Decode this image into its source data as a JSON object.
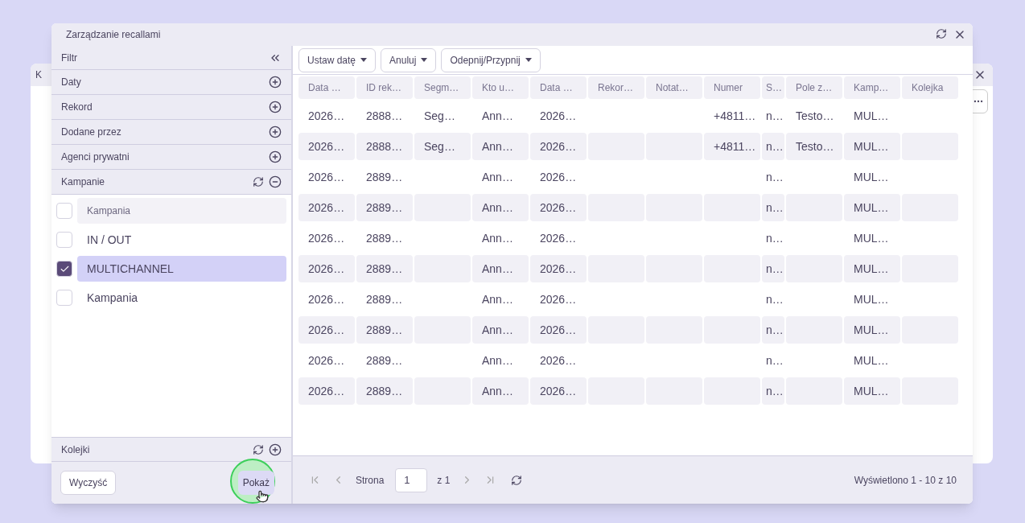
{
  "background_window": {
    "title": "K"
  },
  "dialog": {
    "title": "Zarządzanie recallami"
  },
  "filter": {
    "title": "Filtr",
    "sections": [
      {
        "label": "Daty",
        "expanded": false
      },
      {
        "label": "Rekord",
        "expanded": false
      },
      {
        "label": "Dodane przez",
        "expanded": false
      },
      {
        "label": "Agenci prywatni",
        "expanded": false
      },
      {
        "label": "Kampanie",
        "expanded": true
      }
    ],
    "campaigns": [
      {
        "kind": "header",
        "label": "Kampania",
        "checked": false
      },
      {
        "kind": "item",
        "label": "IN / OUT",
        "checked": false
      },
      {
        "kind": "item",
        "label": "MULTICHANNEL",
        "checked": true
      },
      {
        "kind": "item",
        "label": "Kampania",
        "checked": false
      }
    ],
    "bottom_section": {
      "label": "Kolejki",
      "expanded": false
    },
    "clear_button": "Wyczyść",
    "show_button": "Pokaż"
  },
  "toolbar": [
    "Ustaw datę",
    "Anuluj",
    "Odepnij/Przypnij"
  ],
  "table": {
    "columns": [
      "Data …",
      "ID rek…",
      "Segm…",
      "Kto u…",
      "Data …",
      "Rekor…",
      "Notat…",
      "Numer",
      "S…",
      "Pole z…",
      "Kamp…",
      "Kolejka"
    ],
    "rows": [
      [
        "2026…",
        "2888…",
        "Seg…",
        "Ann…",
        "2026…",
        null,
        null,
        "+4811…",
        "n…",
        "Testo…",
        "MUL…",
        null
      ],
      [
        "2026…",
        "2888…",
        "Seg…",
        "Ann…",
        "2026…",
        null,
        null,
        "+4811…",
        "n…",
        "Testo…",
        "MUL…",
        null
      ],
      [
        "2026…",
        "2889…",
        null,
        "Ann…",
        "2026…",
        null,
        null,
        null,
        "n…",
        null,
        "MUL…",
        null
      ],
      [
        "2026…",
        "2889…",
        null,
        "Ann…",
        "2026…",
        null,
        null,
        null,
        "n…",
        null,
        "MUL…",
        null
      ],
      [
        "2026…",
        "2889…",
        null,
        "Ann…",
        "2026…",
        null,
        null,
        null,
        "n…",
        null,
        "MUL…",
        null
      ],
      [
        "2026…",
        "2889…",
        null,
        "Ann…",
        "2026…",
        null,
        null,
        null,
        "n…",
        null,
        "MUL…",
        null
      ],
      [
        "2026…",
        "2889…",
        null,
        "Ann…",
        "2026…",
        null,
        null,
        null,
        "n…",
        null,
        "MUL…",
        null
      ],
      [
        "2026…",
        "2889…",
        null,
        "Ann…",
        "2026…",
        null,
        null,
        null,
        "n…",
        null,
        "MUL…",
        null
      ],
      [
        "2026…",
        "2889…",
        null,
        "Ann…",
        "2026…",
        null,
        null,
        null,
        "n…",
        null,
        "MUL…",
        null
      ],
      [
        "2026…",
        "2889…",
        null,
        "Ann…",
        "2026…",
        null,
        null,
        null,
        "n…",
        null,
        "MUL…",
        null
      ]
    ]
  },
  "pager": {
    "page_label": "Strona",
    "page": "1",
    "of": "z 1",
    "summary": "Wyświetlono 1 - 10 z 10"
  }
}
